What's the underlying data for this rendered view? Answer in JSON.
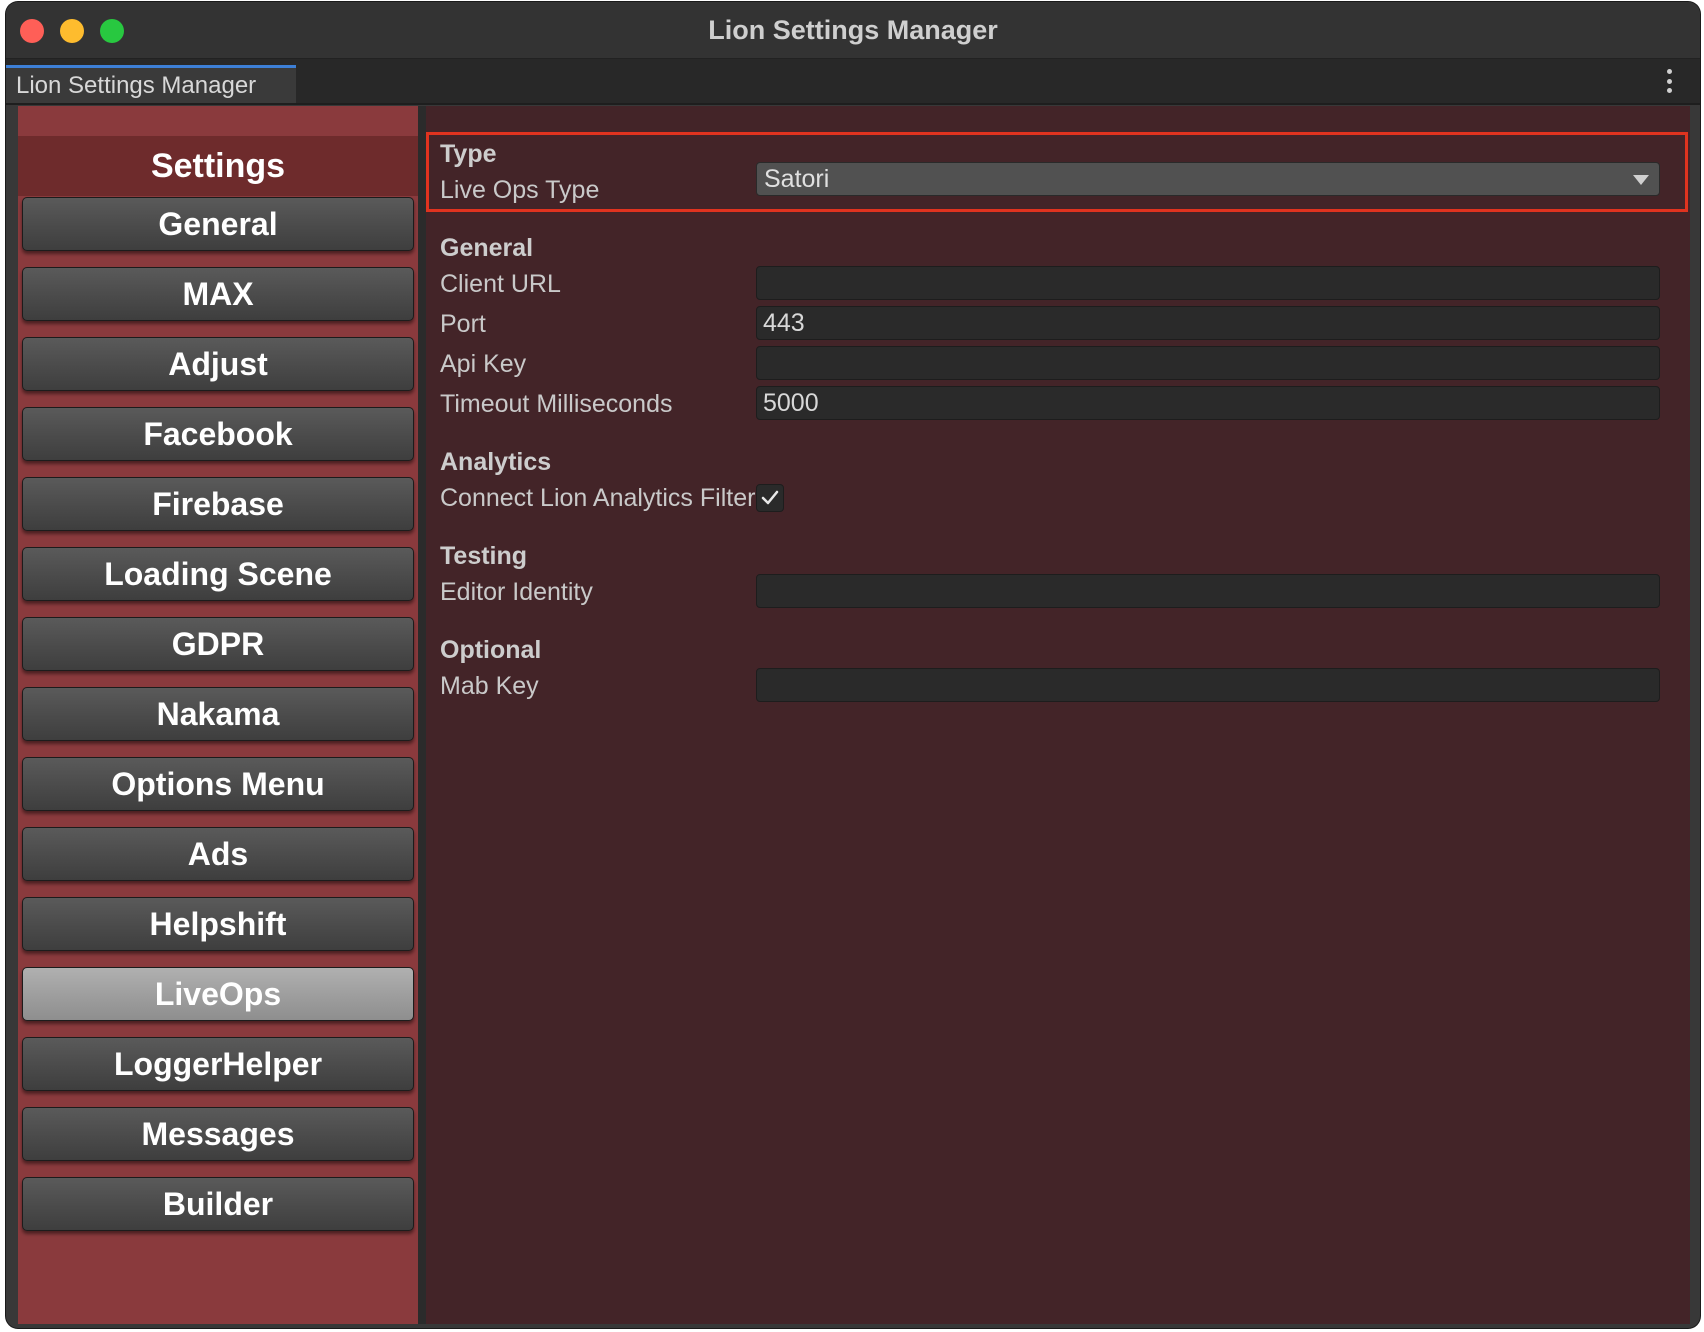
{
  "window": {
    "title": "Lion Settings Manager",
    "tab_label": "Lion Settings Manager"
  },
  "sidebar": {
    "header": "Settings",
    "items": [
      {
        "label": "General",
        "active": false
      },
      {
        "label": "MAX",
        "active": false
      },
      {
        "label": "Adjust",
        "active": false
      },
      {
        "label": "Facebook",
        "active": false
      },
      {
        "label": "Firebase",
        "active": false
      },
      {
        "label": "Loading Scene",
        "active": false
      },
      {
        "label": "GDPR",
        "active": false
      },
      {
        "label": "Nakama",
        "active": false
      },
      {
        "label": "Options Menu",
        "active": false
      },
      {
        "label": "Ads",
        "active": false
      },
      {
        "label": "Helpshift",
        "active": false
      },
      {
        "label": "LiveOps",
        "active": true
      },
      {
        "label": "LoggerHelper",
        "active": false
      },
      {
        "label": "Messages",
        "active": false
      },
      {
        "label": "Builder",
        "active": false
      }
    ]
  },
  "main": {
    "type_section": {
      "title": "Type",
      "live_ops_type_label": "Live Ops Type",
      "live_ops_type_value": "Satori"
    },
    "general_section": {
      "title": "General",
      "client_url_label": "Client URL",
      "client_url_value": "",
      "port_label": "Port",
      "port_value": "443",
      "api_key_label": "Api Key",
      "api_key_value": "",
      "timeout_label": "Timeout Milliseconds",
      "timeout_value": "5000"
    },
    "analytics_section": {
      "title": "Analytics",
      "connect_filter_label": "Connect Lion Analytics Filter",
      "connect_filter_checked": true
    },
    "testing_section": {
      "title": "Testing",
      "editor_identity_label": "Editor Identity",
      "editor_identity_value": ""
    },
    "optional_section": {
      "title": "Optional",
      "mab_key_label": "Mab Key",
      "mab_key_value": ""
    }
  },
  "colors": {
    "sidebar_bg": "#8a3a3d",
    "main_bg": "#432428",
    "highlight_border": "#e0331f"
  }
}
